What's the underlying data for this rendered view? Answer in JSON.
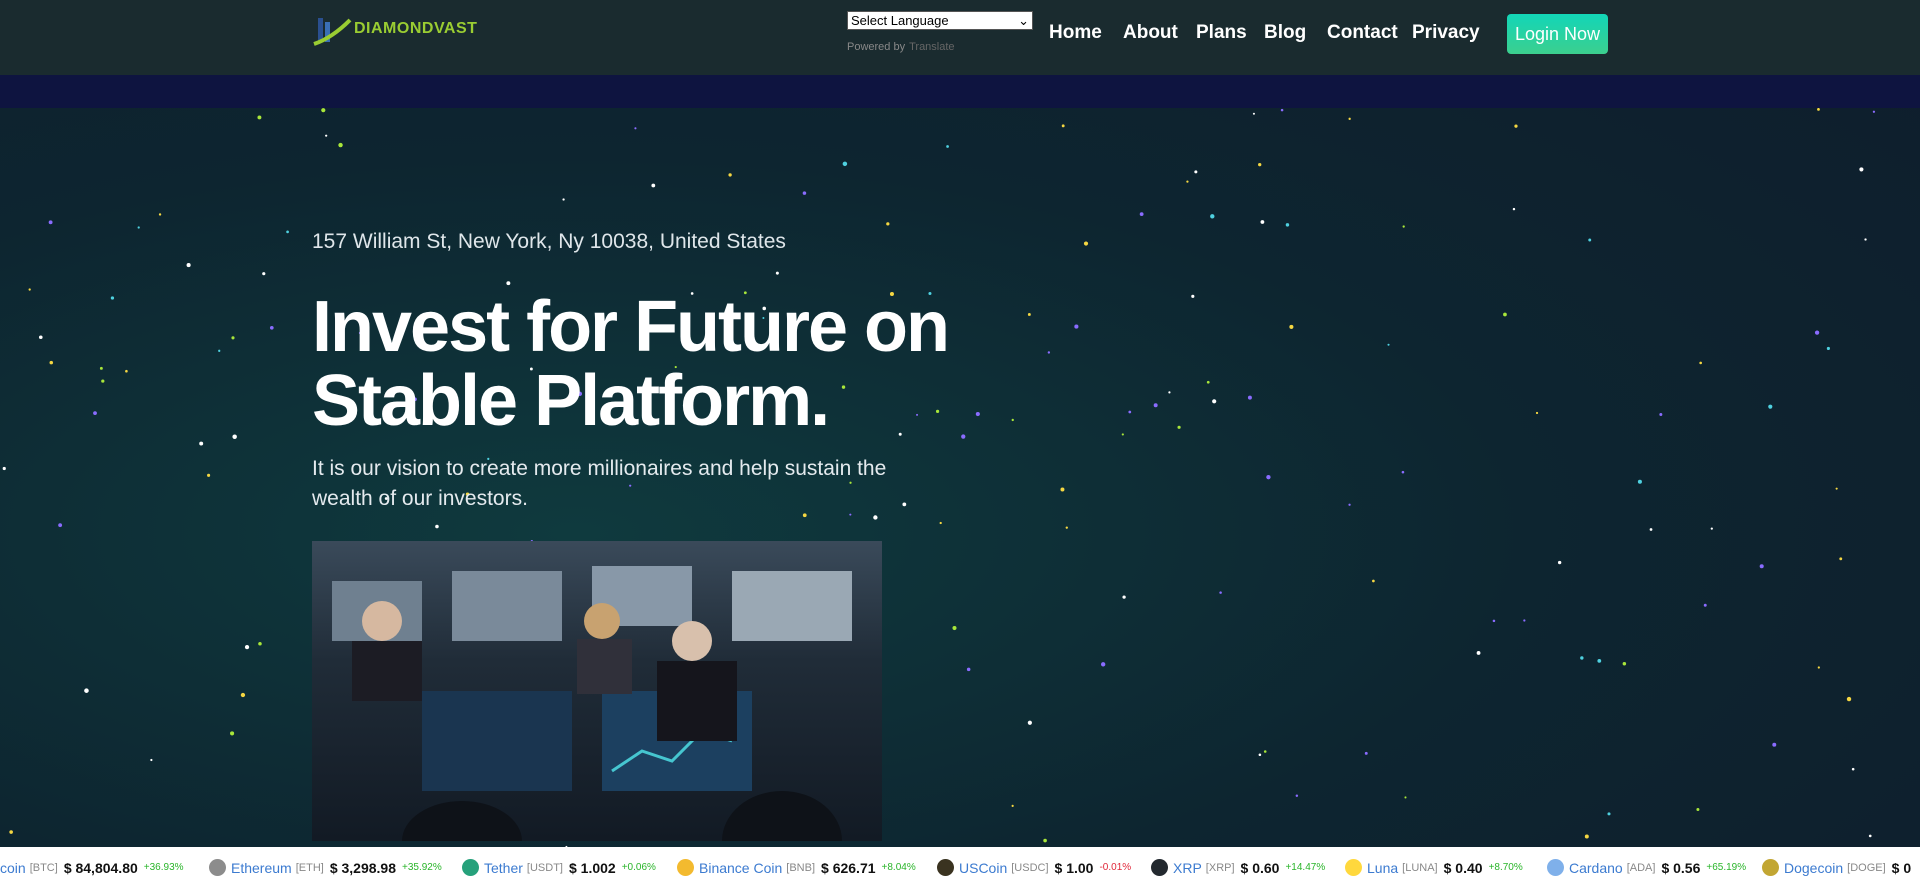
{
  "header": {
    "logo": "DIAMONDVAST",
    "language_select": "Select Language",
    "powered_by": "Powered by",
    "translate": "Translate",
    "nav": [
      "Home",
      "About",
      "Plans",
      "Blog",
      "Contact",
      "Privacy"
    ],
    "login": "Login Now"
  },
  "hero": {
    "address": "157 William St, New York, Ny 10038, United States",
    "title_line1": "Invest for Future on",
    "title_line2": "Stable Platform.",
    "description": "It is our vision to create more millionaires and help sustain the wealth of our investors."
  },
  "ticker": [
    {
      "name": "coin",
      "symbol": "[BTC]",
      "price": "$ 84,804.80",
      "change": "+36.93%",
      "color": "#f7931a",
      "up": true
    },
    {
      "name": "Ethereum",
      "symbol": "[ETH]",
      "price": "$ 3,298.98",
      "change": "+35.92%",
      "color": "#8c8c8c",
      "up": true
    },
    {
      "name": "Tether",
      "symbol": "[USDT]",
      "price": "$ 1.002",
      "change": "+0.06%",
      "color": "#26a17b",
      "up": true
    },
    {
      "name": "Binance Coin",
      "symbol": "[BNB]",
      "price": "$ 626.71",
      "change": "+8.04%",
      "color": "#f3ba2f",
      "up": true
    },
    {
      "name": "USCoin",
      "symbol": "[USDC]",
      "price": "$ 1.00",
      "change": "-0.01%",
      "color": "#3a3320",
      "up": false
    },
    {
      "name": "XRP",
      "symbol": "[XRP]",
      "price": "$ 0.60",
      "change": "+14.47%",
      "color": "#23292f",
      "up": true
    },
    {
      "name": "Luna",
      "symbol": "[LUNA]",
      "price": "$ 0.40",
      "change": "+8.70%",
      "color": "#ffd83d",
      "up": true
    },
    {
      "name": "Cardano",
      "symbol": "[ADA]",
      "price": "$ 0.56",
      "change": "+65.19%",
      "color": "#7fb0ea",
      "up": true
    },
    {
      "name": "Dogecoin",
      "symbol": "[DOGE]",
      "price": "$ 0",
      "change": "",
      "color": "#c2a633",
      "up": true
    }
  ],
  "colors": {
    "up": "#2ab52a",
    "down": "#e0283a",
    "accent": "#12d6b8"
  }
}
